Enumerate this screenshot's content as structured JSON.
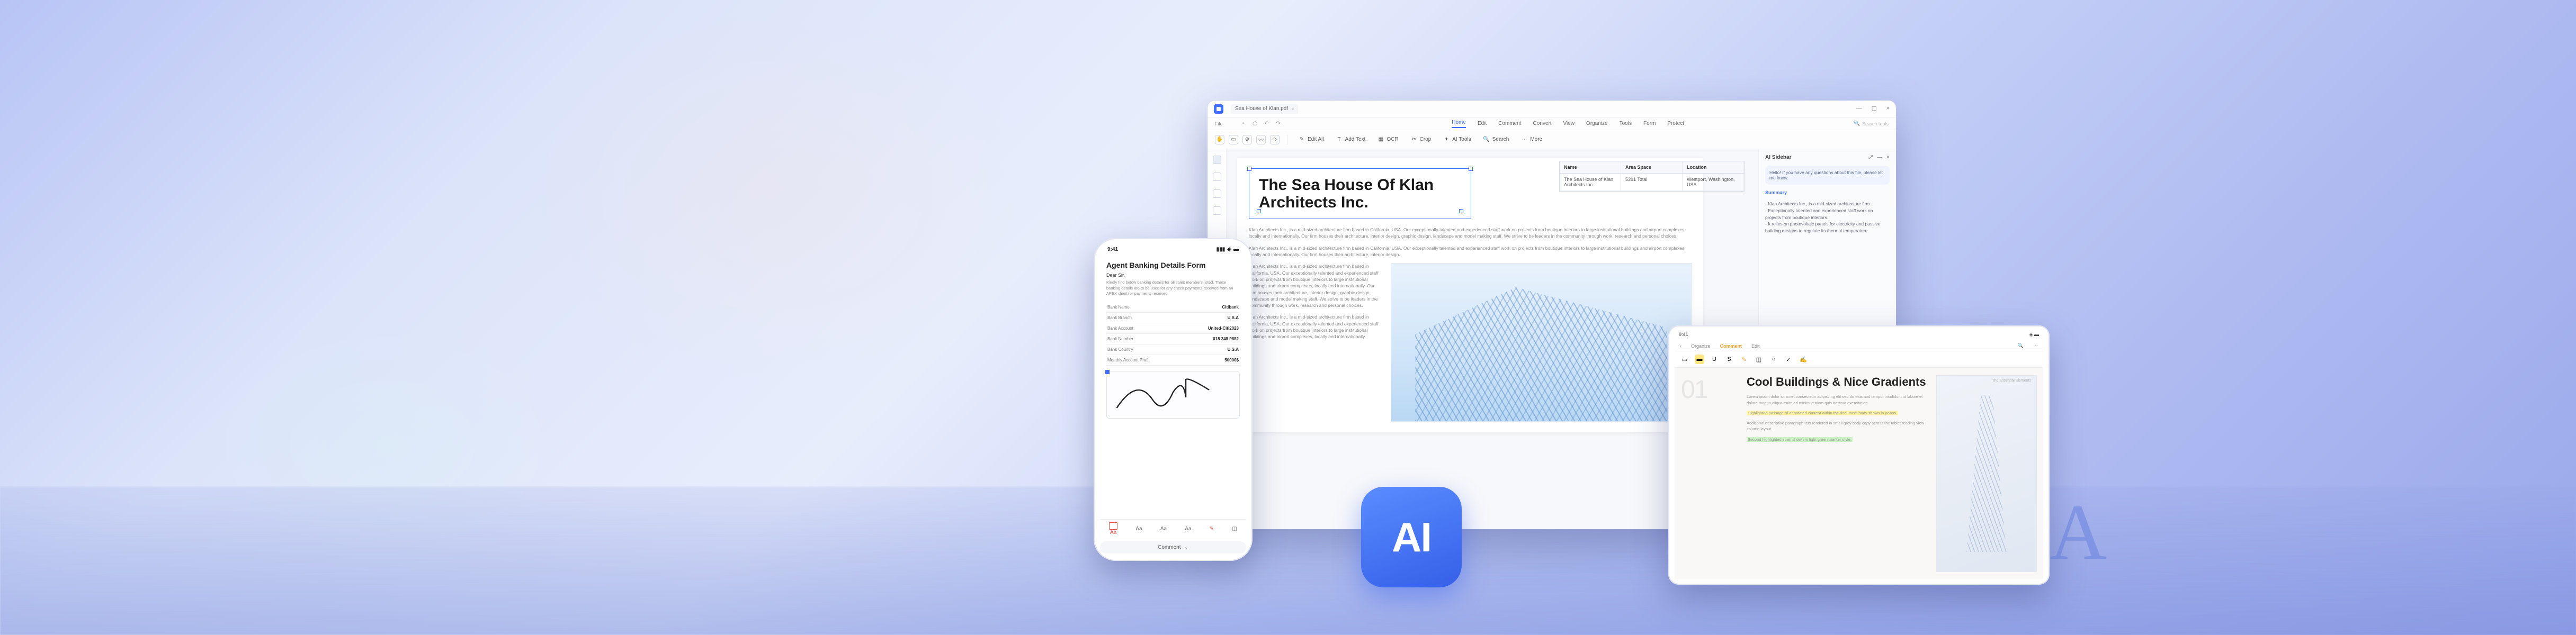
{
  "desktop": {
    "tab_title": "Sea House of Klan.pdf",
    "menu": {
      "file": "File",
      "home": "Home",
      "edit": "Edit",
      "comment": "Comment",
      "convert": "Convert",
      "view": "View",
      "organize": "Organize",
      "tools": "Tools",
      "form": "Form",
      "protect": "Protect",
      "search_placeholder": "Search tools"
    },
    "toolbar": {
      "edit_all": "Edit All",
      "add_text": "Add Text",
      "ocr": "OCR",
      "crop": "Crop",
      "ai_tools": "AI Tools",
      "search": "Search",
      "more": "More"
    },
    "document": {
      "headline": "The Sea House Of Klan Architects Inc.",
      "table": {
        "headers": [
          "Name",
          "Area Space",
          "Location"
        ],
        "row": [
          "The Sea House of Klan Architects Inc.",
          "5391 Total",
          "Westport, Washington, USA"
        ]
      },
      "para1": "Klan Architects Inc., is a mid-sized architecture firm based in California, USA. Our exceptionally talented and experienced staff work on projects from boutique interiors to large institutional buildings and airport complexes, locally and internationally. Our firm houses their architecture, interior design, graphic design, landscape and model making staff. We strive to be leaders in the community through work, research and personal choices.",
      "para2": "Klan Architects Inc., is a mid-sized architecture firm based in California, USA. Our exceptionally talented and experienced staff work on projects from boutique interiors to large institutional buildings and airport complexes, locally and internationally. Our firm houses their architecture, interior design.",
      "para3": "Klan Architects Inc., is a mid-sized architecture firm based in California, USA. Our exceptionally talented and experienced staff work on projects from boutique interiors to large institutional buildings and airport complexes, locally and internationally. Our firm houses their architecture, interior design, graphic design, landscape and model making staff. We strive to be leaders in the community through work, research and personal choices.",
      "para4": "Klan Architects Inc., is a mid-sized architecture firm based in California, USA. Our exceptionally talented and experienced staff work on projects from boutique interiors to large institutional buildings and airport complexes, locally and internationally."
    },
    "ai_sidebar": {
      "title": "AI Sidebar",
      "prompt": "Hello! If you have any questions about this file, please let me know.",
      "section": "Summary",
      "items": [
        "Klan Architects Inc., is a mid-sized architecture firm.",
        "Exceptionally talented and experienced staff work on projects from boutique interiors.",
        "It relies on photovoltaic panels for electricity and passive building designs to regulate its thermal temperature."
      ]
    }
  },
  "phone": {
    "time": "9:41",
    "form_title": "Agent Banking Details Form",
    "greeting": "Dear Sir,",
    "body": "Kindly find below banking details for all sales members listed. These banking details are to be used for any check payments received from an APEX client for payments received.",
    "rows": [
      {
        "k": "Bank Name",
        "v": "Citibank"
      },
      {
        "k": "Bank Branch",
        "v": "U.S.A"
      },
      {
        "k": "Bank Account",
        "v": "United-Citi2023"
      },
      {
        "k": "Bank Number",
        "v": "018 248 9882"
      },
      {
        "k": "Bank Country",
        "v": "U.S.A"
      },
      {
        "k": "Monthly Account Profit",
        "v": "50000$"
      }
    ],
    "tools": [
      "Aa",
      "Aa",
      "Aa",
      "Aa"
    ],
    "bottom_label": "Comment"
  },
  "tablet": {
    "time": "9:41",
    "tabs": {
      "organize": "Organize",
      "comment": "Comment",
      "edit": "Edit"
    },
    "section_num": "01",
    "heading": "Cool Buildings & Nice Gradients",
    "right_label": "The Essential Elements",
    "para1": "Lorem ipsum dolor sit amet consectetur adipiscing elit sed do eiusmod tempor incididunt ut labore et dolore magna aliqua enim ad minim veniam quis nostrud exercitation.",
    "hl1": "Highlighted passage of annotated content within the document body shown in yellow.",
    "para2": "Additional descriptive paragraph text rendered in small grey body copy across the tablet reading view column layout.",
    "hl2": "Second highlighted span shown in light green marker style."
  },
  "ai_badge": "AI",
  "letter": "A"
}
